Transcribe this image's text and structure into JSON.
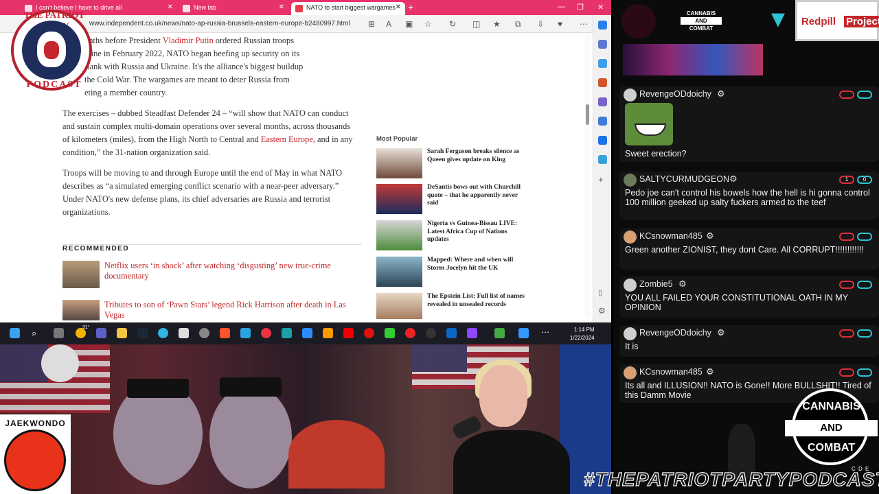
{
  "browser": {
    "tabs": [
      {
        "label": "I can't believe I have to drive all",
        "active": false
      },
      {
        "label": "New tab",
        "active": false
      },
      {
        "label": "NATO to start biggest wargames",
        "active": true
      }
    ],
    "url": "www.independent.co.uk/news/nato-ap-russia-brussels-eastern-europe-b2480997.html"
  },
  "article": {
    "p1_a": "onths before President ",
    "p1_link": "Vladimir Putin",
    "p1_b": " ordered Russian troops",
    "p1_line2": "raine in February 2022, NATO began beefing up security on its",
    "p1_line3": "flank with Russia and Ukraine. It's the alliance's biggest buildup",
    "p1_line4": "the Cold War. The wargames are meant to deter Russia from",
    "p1_line5": "eting a member country.",
    "p2_a": "The exercises – dubbed Steadfast Defender 24 – “will show that NATO can conduct and sustain complex multi-domain operations over several months, across thousands of kilometers (miles), from the High North to Central and ",
    "p2_link": "Eastern Europe",
    "p2_b": ", and in any condition,” the 31-nation organization said.",
    "p3": "Troops will be moving to and through Europe until the end of May in what NATO describes as “a simulated emerging conflict scenario with a near-peer adversary.” Under NATO's new defense plans, its chief adversaries are Russia and terrorist organizations."
  },
  "recommended": {
    "heading": "RECOMMENDED",
    "items": [
      {
        "title": "Netflix users ‘in shock’ after watching ‘disgusting’ new true-crime documentary"
      },
      {
        "title": "Tributes to son of ‘Pawn Stars’ legend Rick Harrison after death in Las Vegas"
      }
    ]
  },
  "most_popular": {
    "heading": "Most Popular",
    "items": [
      {
        "title": "Sarah Ferguson breaks silence as Queen gives update on King"
      },
      {
        "title": "DeSantis bows out with Churchill quote – that he apparently never said"
      },
      {
        "title": "Nigeria vs Guinea-Bissau LIVE: Latest Africa Cup of Nations updates"
      },
      {
        "title": "Mapped: Where and when will Storm Jocelyn hit the UK"
      },
      {
        "title": "The Epstein List: Full list of names revealed in unsealed records"
      }
    ]
  },
  "overlay_logo": {
    "top": "THE PATRIOT PARTY",
    "bottom": "PODCAST"
  },
  "taskbar": {
    "time": "1:14 PM",
    "date": "1/22/2024",
    "weather": "31°"
  },
  "chat": {
    "brand_cannabis": "CANNABIS",
    "brand_and": "AND",
    "brand_combat": "COMBAT",
    "redpill_a": "Redpill",
    "redpill_b": "Project",
    "messages": [
      {
        "user": "RevengeODdoichy",
        "text": "Sweet erection?",
        "has_image": true
      },
      {
        "user": "SALTYCURMUDGEON",
        "text": "Pedo joe can't control his bowels how the hell is hi gonna control 100 million geeked up salty fuckers armed to the teef",
        "pill_a": "1",
        "pill_b": "0"
      },
      {
        "user": "KCsnowman485",
        "text": "Green another ZIONIST, they dont Care. All CORRUPT!!!!!!!!!!!!"
      },
      {
        "user": "Zombie5",
        "text": "YOU ALL FAILED YOUR CONSTITUTIONAL OATH IN MY OPINION"
      },
      {
        "user": "RevengeODdoichy",
        "text": "It is"
      },
      {
        "user": "KCsnowman485",
        "text": "Its all and ILLUSION!! NATO is Gone!! More BULLSHIT!! Tired of this Damm Movie"
      }
    ]
  },
  "webcam": {
    "jaekwondo": "JAEKWONDO",
    "hashtag": "#THEPATRIOTPARTYPODCAST",
    "cc_top": "CANNABIS",
    "cc_and": "AND",
    "cc_bot": "COMBAT",
    "cde": "C D E"
  }
}
